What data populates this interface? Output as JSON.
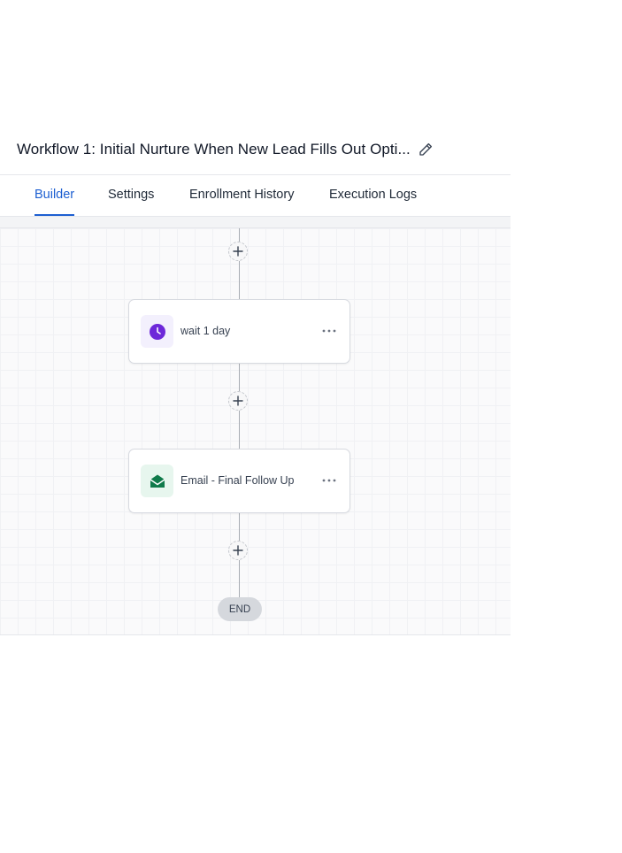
{
  "header": {
    "title": "Workflow 1: Initial Nurture When New Lead Fills Out Opti...",
    "edit_icon": "pencil-icon"
  },
  "tabs": [
    {
      "label": "Builder",
      "active": true
    },
    {
      "label": "Settings",
      "active": false
    },
    {
      "label": "Enrollment History",
      "active": false
    },
    {
      "label": "Execution Logs",
      "active": false
    }
  ],
  "workflow": {
    "steps": [
      {
        "type": "wait",
        "label": "wait 1 day",
        "icon": "clock-icon",
        "icon_bg": "#f3f0fd",
        "icon_color": "#6d28d9"
      },
      {
        "type": "email",
        "label": "Email - Final Follow Up",
        "icon": "envelope-open-icon",
        "icon_bg": "#e7f6ee",
        "icon_color": "#0f7a4a"
      }
    ],
    "add_icon": "plus-icon",
    "menu_icon": "more-horizontal-icon",
    "end_label": "END"
  },
  "colors": {
    "accent": "#1d5fd1"
  }
}
